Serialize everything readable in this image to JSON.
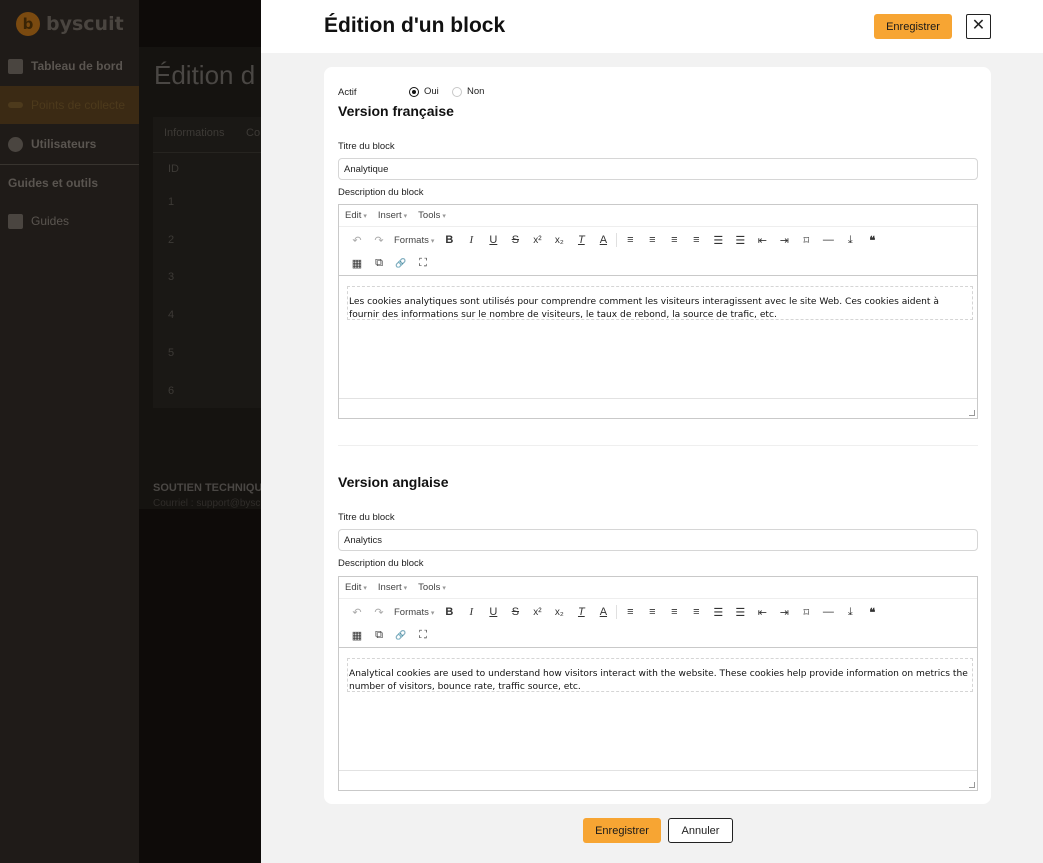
{
  "app": {
    "brand": "byscuit",
    "nav": [
      {
        "label": "Tableau de bord",
        "icon": "dashboard-icon"
      },
      {
        "label": "Points de collecte",
        "icon": "collect-icon"
      },
      {
        "label": "Utilisateurs",
        "icon": "user-icon"
      },
      {
        "label": "Guides et outils",
        "icon": ""
      },
      {
        "label": "Guides",
        "icon": "guide-icon"
      }
    ],
    "page_title": "Édition d",
    "tabs": [
      "Informations",
      "Co"
    ],
    "table_header": "ID",
    "rows": [
      "1",
      "2",
      "3",
      "4",
      "5",
      "6"
    ],
    "support_title": "SOUTIEN TECHNIQUE",
    "support_email": "Courriel : support@bysc"
  },
  "drawer": {
    "title": "Édition d'un block",
    "save_label": "Enregistrer",
    "close_glyph": "✕",
    "active_label": "Actif",
    "radio_yes": "Oui",
    "radio_no": "Non",
    "active_value": "Oui",
    "french": {
      "section": "Version française",
      "title_label": "Titre du block",
      "title_value": "Analytique",
      "desc_label": "Description du block",
      "content": "Les cookies analytiques sont utilisés pour comprendre comment les visiteurs interagissent avec le site Web. Ces cookies aident à fournir des informations sur le nombre de visiteurs, le taux de rebond, la source de trafic, etc."
    },
    "english": {
      "section": "Version anglaise",
      "title_label": "Titre du block",
      "title_value": "Analytics",
      "desc_label": "Description du block",
      "content": "Analytical cookies are used to understand how visitors interact with the website. These cookies help provide information on metrics the number of visitors, bounce rate, traffic source, etc."
    },
    "editor": {
      "menus": [
        "Edit",
        "Insert",
        "Tools"
      ],
      "formats_label": "Formats",
      "glyphs": {
        "undo": "↶",
        "redo": "↷",
        "bold": "B",
        "italic": "I",
        "underline": "U",
        "strike": "S",
        "sup": "x²",
        "sub": "x₂",
        "clear": "T",
        "color": "A",
        "align_left": "≡",
        "align_center": "≡",
        "align_right": "≡",
        "justify": "≡",
        "bullets": "☰",
        "numbers": "☰",
        "outdent": "⇤",
        "indent": "⇥",
        "bookmark": "⌑",
        "hr": "—",
        "upload": "⤓",
        "quote": "❝",
        "table": "▦",
        "image": "⧉",
        "link": "🔗",
        "fullscreen": "⛶"
      }
    },
    "footer_save": "Enregistrer",
    "footer_cancel": "Annuler"
  },
  "colors": {
    "accent": "#f7a533",
    "overlay": "#0e0b09"
  }
}
